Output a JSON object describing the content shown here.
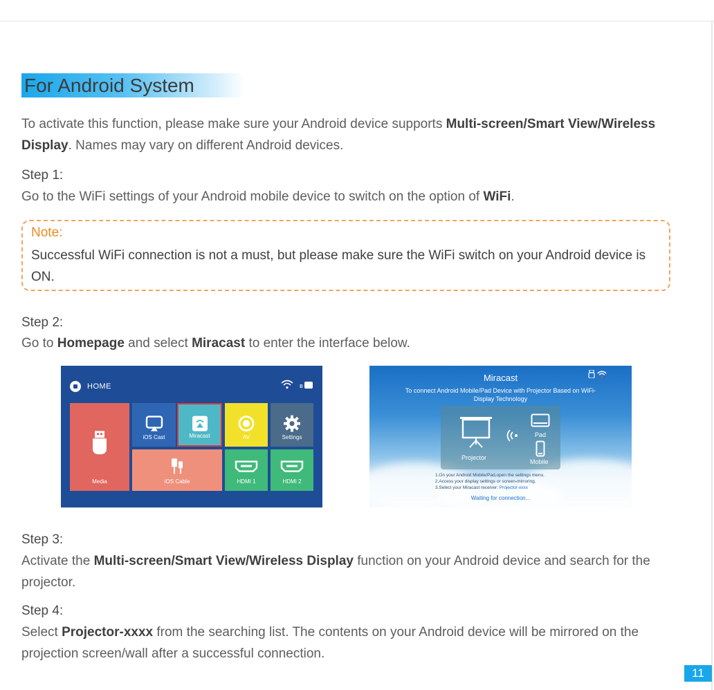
{
  "section": {
    "title": "For Android System"
  },
  "intro": {
    "pre": "To activate this function, please make sure your Android device supports ",
    "bold": "Multi-screen/Smart View/Wireless Display",
    "post": ". Names may vary on different Android devices."
  },
  "step1": {
    "label": "Step 1:",
    "pre": "Go to the WiFi settings of your Android mobile device to switch on the option of ",
    "bold": "WiFi",
    "post": "."
  },
  "note": {
    "label": "Note:",
    "text": "Successful WiFi connection is not a must, but please make sure the WiFi switch on your Android device is ON."
  },
  "step2": {
    "label": "Step 2:",
    "pre": "Go to ",
    "bold1": "Homepage",
    "mid": " and select ",
    "bold2": "Miracast",
    "post": " to enter the interface below."
  },
  "home_screen": {
    "header": "HOME",
    "tiles": {
      "media": "Media",
      "ios_cast": "iOS Cast",
      "miracast": "Miracast",
      "av": "AV",
      "settings": "Settings",
      "ios_cable": "iOS Cable",
      "hdmi1": "HDMI 1",
      "hdmi2": "HDMI 2"
    },
    "colors": {
      "background": "#1f4c96",
      "selected_border": "#d83a3a"
    }
  },
  "miracast_screen": {
    "title": "Miracast",
    "subtitle": "To connect Android Mobile/Pad Device with Projector Based on WiFi-Display Technology",
    "projector_label": "Projector",
    "pad_label": "Pad",
    "mobile_label": "Mobile",
    "instruction1": "1.On your Android Mobile/Pad,open the settings menu.",
    "instruction2": "2.Access your display settings or screen-mirroring.",
    "instruction3_pre": "3.Select your Miracast receiver: ",
    "instruction3_hl": "Projector-xxxx",
    "waiting": "Waiting for connection..."
  },
  "step3": {
    "label": "Step 3:",
    "pre": "Activate the ",
    "bold": "Multi-screen/Smart View/Wireless Display",
    "post": " function on your Android device and search for the projector."
  },
  "step4": {
    "label": "Step 4:",
    "pre": "Select ",
    "bold": "Projector-xxxx",
    "post": " from the searching list. The contents on your Android device will be mirrored on the projection screen/wall after a successful connection."
  },
  "page_number": "11",
  "colors": {
    "accent": "#1aa7ea",
    "note": "#ef8a1e"
  }
}
